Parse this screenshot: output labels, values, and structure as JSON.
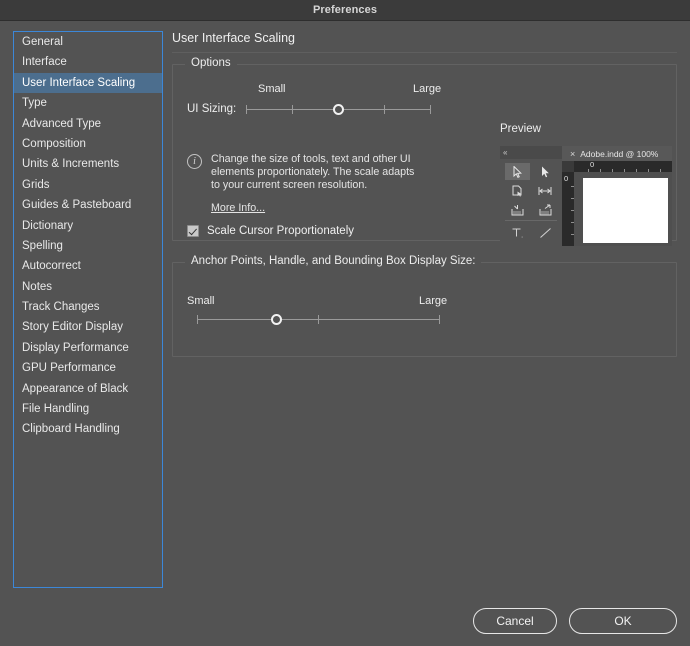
{
  "window": {
    "title": "Preferences"
  },
  "sidebar": {
    "items": [
      {
        "label": "General",
        "selected": false
      },
      {
        "label": "Interface",
        "selected": false
      },
      {
        "label": "User Interface Scaling",
        "selected": true
      },
      {
        "label": "Type",
        "selected": false
      },
      {
        "label": "Advanced Type",
        "selected": false
      },
      {
        "label": "Composition",
        "selected": false
      },
      {
        "label": "Units & Increments",
        "selected": false
      },
      {
        "label": "Grids",
        "selected": false
      },
      {
        "label": "Guides & Pasteboard",
        "selected": false
      },
      {
        "label": "Dictionary",
        "selected": false
      },
      {
        "label": "Spelling",
        "selected": false
      },
      {
        "label": "Autocorrect",
        "selected": false
      },
      {
        "label": "Notes",
        "selected": false
      },
      {
        "label": "Track Changes",
        "selected": false
      },
      {
        "label": "Story Editor Display",
        "selected": false
      },
      {
        "label": "Display Performance",
        "selected": false
      },
      {
        "label": "GPU Performance",
        "selected": false
      },
      {
        "label": "Appearance of Black",
        "selected": false
      },
      {
        "label": "File Handling",
        "selected": false
      },
      {
        "label": "Clipboard Handling",
        "selected": false
      }
    ]
  },
  "page": {
    "title": "User Interface Scaling"
  },
  "options": {
    "group_label": "Options",
    "ui_sizing_label": "UI Sizing:",
    "small_label": "Small",
    "large_label": "Large",
    "slider_value_percent": 50,
    "info_text": "Change the size of tools, text and other UI elements proportionately. The scale adapts to your current screen resolution.",
    "more_info_label": "More Info...",
    "scale_cursor_label": "Scale Cursor Proportionately",
    "scale_cursor_checked": true
  },
  "preview": {
    "title": "Preview",
    "collapse_label": "«",
    "document_tab": "Adobe.indd @ 100%",
    "close_label": "×",
    "ruler_zero_h": "0",
    "ruler_zero_v": "0"
  },
  "anchor": {
    "group_label": "Anchor Points, Handle, and Bounding Box Display Size:",
    "small_label": "Small",
    "large_label": "Large",
    "slider_value_percent": 33
  },
  "footer": {
    "cancel_label": "Cancel",
    "ok_label": "OK"
  },
  "colors": {
    "dialog_bg": "#535353",
    "titlebar_bg": "#3b3b3b",
    "selection_blue": "#4c6e8e",
    "focus_border_blue": "#3c87d8",
    "text": "#ededed"
  }
}
